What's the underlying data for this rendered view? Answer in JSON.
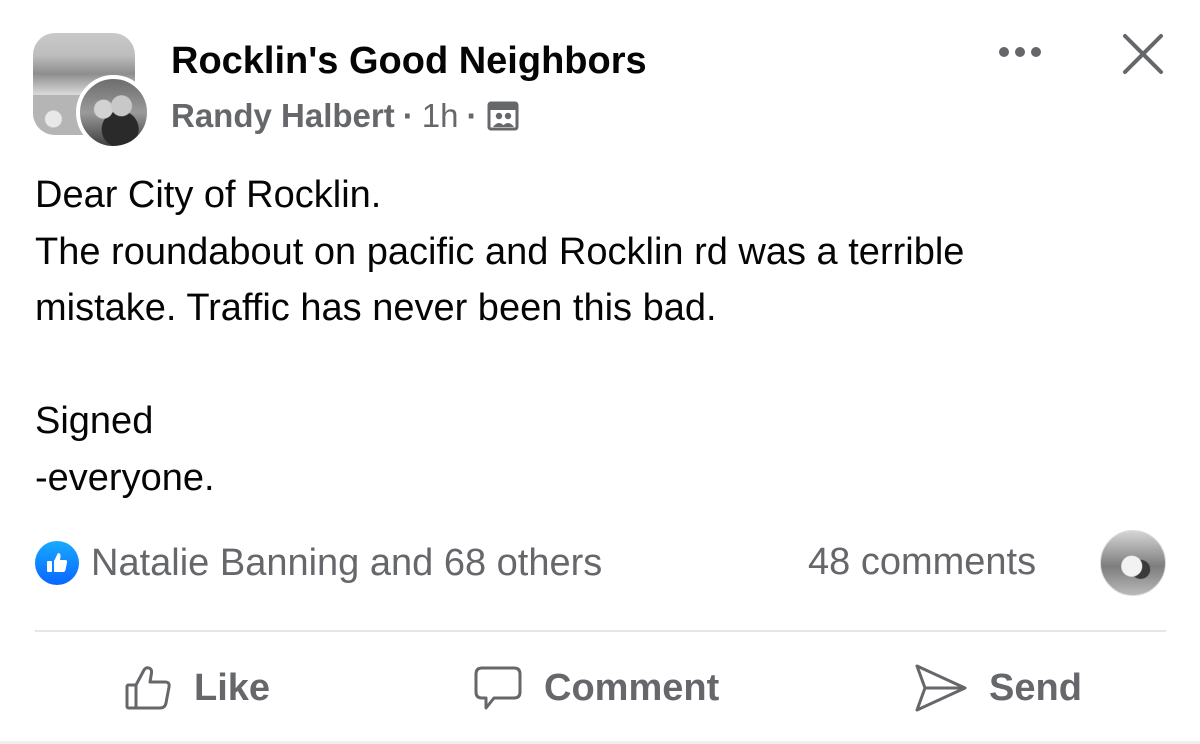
{
  "header": {
    "group_name": "Rocklin's Good Neighbors",
    "author": "Randy Halbert",
    "separator": "·",
    "time": "1h",
    "audience_icon": "members-icon",
    "more_icon": "more-dots-icon",
    "close_icon": "close-icon"
  },
  "body": {
    "lines": [
      "Dear City of Rocklin.",
      "The roundabout on pacific and Rocklin rd was a terrible",
      "mistake. Traffic has never been this bad.",
      "",
      "Signed",
      "-everyone."
    ]
  },
  "reactions": {
    "icon": "like-reaction-icon",
    "summary": "Natalie Banning and 68 others",
    "comments": "48 comments"
  },
  "actions": {
    "like_label": "Like",
    "comment_label": "Comment",
    "send_label": "Send"
  },
  "colors": {
    "primary_text": "#050505",
    "secondary_text": "#65676b",
    "like_blue": "#0866ff",
    "divider": "#e4e6eb"
  }
}
